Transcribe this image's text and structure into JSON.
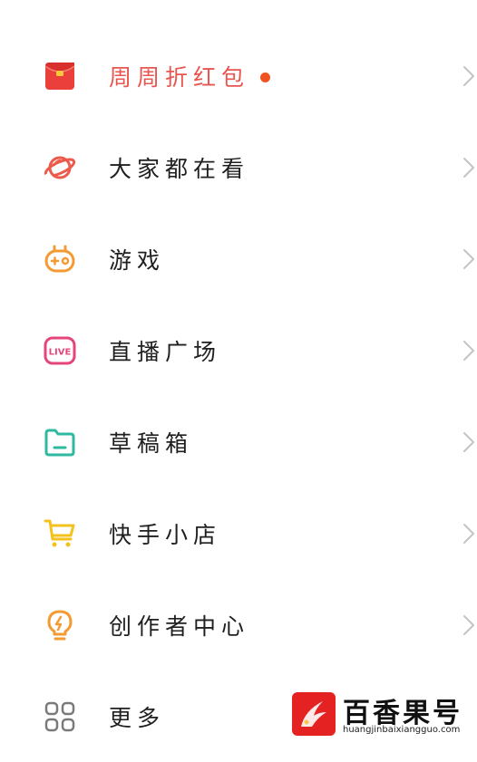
{
  "menu": {
    "items": [
      {
        "label": "周周折红包",
        "icon": "red-envelope-icon",
        "color": "#e8564f",
        "badge": "dot"
      },
      {
        "label": "大家都在看",
        "icon": "planet-icon",
        "color": "#ec5a4c"
      },
      {
        "label": "游戏",
        "icon": "gamepad-icon",
        "color": "#f39a33"
      },
      {
        "label": "直播广场",
        "icon": "live-icon",
        "color": "#e5457a",
        "icon_text": "LIVE"
      },
      {
        "label": "草稿箱",
        "icon": "folder-icon",
        "color": "#2fb9a1"
      },
      {
        "label": "快手小店",
        "icon": "shopping-cart-icon",
        "color": "#f4c21c"
      },
      {
        "label": "创作者中心",
        "icon": "lightbulb-icon",
        "color": "#f39a33"
      },
      {
        "label": "更多",
        "icon": "grid-icon",
        "color": "#7a7a7a"
      }
    ]
  },
  "watermark": {
    "name": "百香果号",
    "url": "huangjinbaixiangguo.com",
    "color": "#e52222"
  }
}
